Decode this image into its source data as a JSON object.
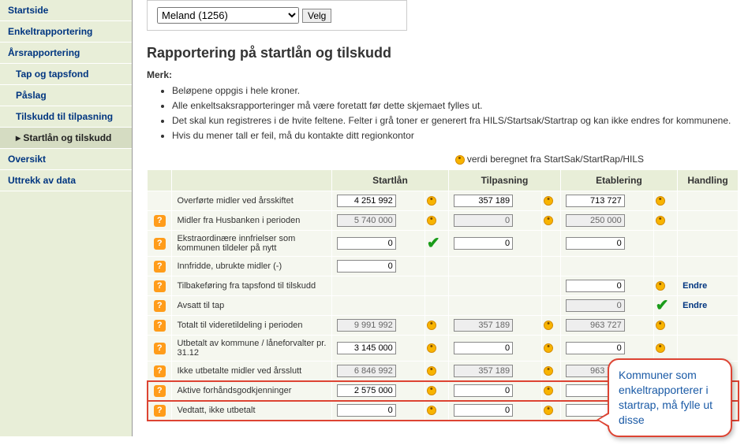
{
  "sidebar": {
    "items": [
      {
        "label": "Startside",
        "sub": false,
        "active": false
      },
      {
        "label": "Enkeltrapportering",
        "sub": false,
        "active": false
      },
      {
        "label": "Årsrapportering",
        "sub": false,
        "active": false
      },
      {
        "label": "Tap og tapsfond",
        "sub": true,
        "active": false
      },
      {
        "label": "Påslag",
        "sub": true,
        "active": false
      },
      {
        "label": "Tilskudd til tilpasning",
        "sub": true,
        "active": false
      },
      {
        "label": "Startlån og tilskudd",
        "sub": true,
        "active": true
      },
      {
        "label": "Oversikt",
        "sub": false,
        "active": false
      },
      {
        "label": "Uttrekk av data",
        "sub": false,
        "active": false
      }
    ]
  },
  "selector": {
    "selected": "Meland (1256)",
    "button": "Velg"
  },
  "heading": "Rapportering på startlån og tilskudd",
  "merk_label": "Merk:",
  "merk_items": [
    "Beløpene oppgis i hele kroner.",
    "Alle enkeltsaksrapporteringer må være foretatt før dette skjemaet fylles ut.",
    "Det skal kun registreres i de hvite feltene. Felter i grå toner er generert fra HILS/Startsak/Startrap og kan ikke endres for kommunene.",
    "Hvis du mener tall er feil, må du kontakte ditt regionkontor"
  ],
  "legend_text": " verdi beregnet fra StartSak/StartRap/HILS",
  "table": {
    "headers": [
      "",
      "",
      "Startlån",
      "Tilpasning",
      "Etablering",
      "Handling"
    ],
    "rows": [
      {
        "help": false,
        "label": "Overførte midler ved årsskiftet",
        "c1": {
          "v": "4 251 992",
          "ro": false,
          "m": true
        },
        "c2": {
          "v": "357 189",
          "ro": false,
          "m": true
        },
        "c3": {
          "v": "713 727",
          "ro": false,
          "m": true
        },
        "action": ""
      },
      {
        "help": true,
        "label": "Midler fra Husbanken i perioden",
        "c1": {
          "v": "5 740 000",
          "ro": true,
          "m": true
        },
        "c2": {
          "v": "0",
          "ro": true,
          "m": true
        },
        "c3": {
          "v": "250 000",
          "ro": true,
          "m": true
        },
        "action": ""
      },
      {
        "help": true,
        "label": "Ekstraordinære innfrielser som kommunen tildeler på nytt",
        "c1": {
          "v": "0",
          "ro": false,
          "m": false,
          "check": true
        },
        "c2": {
          "v": "0",
          "ro": false,
          "m": false
        },
        "c3": {
          "v": "0",
          "ro": false,
          "m": false
        },
        "action": ""
      },
      {
        "help": true,
        "label": "Innfridde, ubrukte midler (-)",
        "c1": {
          "v": "0",
          "ro": false,
          "m": false
        },
        "c2": null,
        "c3": null,
        "action": ""
      },
      {
        "help": true,
        "label": "Tilbakeføring fra tapsfond til tilskudd",
        "c1": null,
        "c2": null,
        "c3": {
          "v": "0",
          "ro": false,
          "m": true
        },
        "action": "Endre"
      },
      {
        "help": true,
        "label": "Avsatt til tap",
        "c1": null,
        "c2": null,
        "c3": {
          "v": "0",
          "ro": true,
          "m": false,
          "check": true
        },
        "action": "Endre"
      },
      {
        "help": true,
        "label": "Totalt til videretildeling i perioden",
        "c1": {
          "v": "9 991 992",
          "ro": true,
          "m": true
        },
        "c2": {
          "v": "357 189",
          "ro": true,
          "m": true
        },
        "c3": {
          "v": "963 727",
          "ro": true,
          "m": true
        },
        "action": ""
      },
      {
        "help": true,
        "label": "Utbetalt av kommune / låneforvalter pr. 31.12",
        "c1": {
          "v": "3 145 000",
          "ro": false,
          "m": true
        },
        "c2": {
          "v": "0",
          "ro": false,
          "m": true
        },
        "c3": {
          "v": "0",
          "ro": false,
          "m": true
        },
        "action": ""
      },
      {
        "help": true,
        "label": "Ikke utbetalte midler ved årsslutt",
        "c1": {
          "v": "6 846 992",
          "ro": true,
          "m": true
        },
        "c2": {
          "v": "357 189",
          "ro": true,
          "m": true
        },
        "c3": {
          "v": "963 727",
          "ro": true,
          "m": true
        },
        "action": ""
      },
      {
        "help": true,
        "label": "Aktive forhåndsgodkjenninger",
        "c1": {
          "v": "2 575 000",
          "ro": false,
          "m": true
        },
        "c2": {
          "v": "0",
          "ro": false,
          "m": true
        },
        "c3": {
          "v": "0",
          "ro": false,
          "m": true
        },
        "action": "",
        "hl": true
      },
      {
        "help": true,
        "label": "Vedtatt, ikke utbetalt",
        "c1": {
          "v": "0",
          "ro": false,
          "m": true
        },
        "c2": {
          "v": "0",
          "ro": false,
          "m": true
        },
        "c3": {
          "v": "0",
          "ro": false,
          "m": true
        },
        "action": "",
        "hl": true
      }
    ]
  },
  "callout": "Kommuner som enkeltrapporterer i startrap, må fylle ut disse"
}
